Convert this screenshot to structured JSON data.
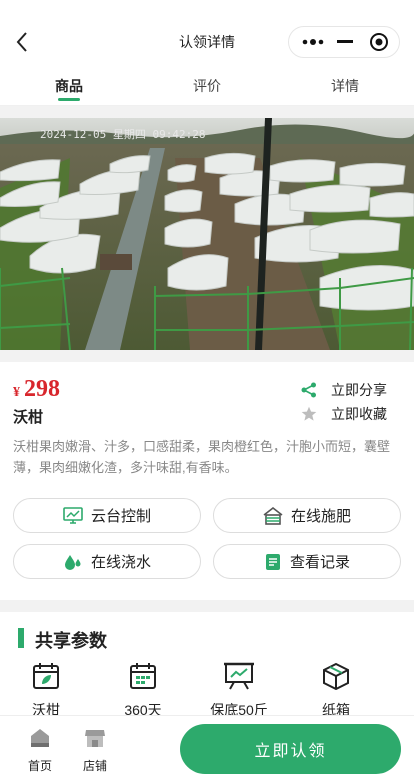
{
  "header": {
    "title": "认领详情"
  },
  "tabs": [
    {
      "label": "商品"
    },
    {
      "label": "评价"
    },
    {
      "label": "详情"
    }
  ],
  "product": {
    "currency": "¥",
    "price": "298",
    "name": "沃柑",
    "description": "沃柑果肉嫩滑、汁多，口感甜柔，果肉橙红色，汁胞小而短，囊壁薄，果肉细嫩化渣，多汁味甜,有香味。",
    "photo_overlay": "2024-12-05 星期四 09:42:28"
  },
  "actions": {
    "share": "立即分享",
    "favorite": "立即收藏"
  },
  "functions": [
    {
      "label": "云台控制"
    },
    {
      "label": "在线施肥"
    },
    {
      "label": "在线浇水"
    },
    {
      "label": "查看记录"
    }
  ],
  "params": {
    "title": "共享参数",
    "items": [
      {
        "label": "沃柑"
      },
      {
        "label": "360天"
      },
      {
        "label": "保底50斤"
      },
      {
        "label": "纸箱"
      }
    ]
  },
  "bottom": {
    "home": "首页",
    "store": "店铺",
    "claim": "立即认领"
  },
  "colors": {
    "accent": "#2daa6c",
    "price": "#d8262c"
  }
}
